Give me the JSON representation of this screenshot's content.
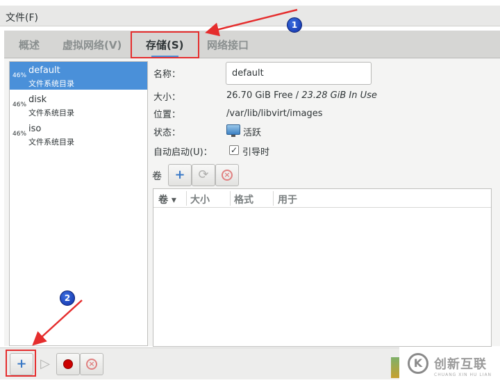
{
  "menubar": {
    "file_menu": "文件(F)"
  },
  "tabs": [
    {
      "label": "概述",
      "active": false
    },
    {
      "label": "虚拟网络(V)",
      "active": false
    },
    {
      "label": "存储(S)",
      "active": true
    },
    {
      "label": "网络接口",
      "active": false
    }
  ],
  "pools": [
    {
      "percent": "46%",
      "name": "default",
      "type": "文件系统目录",
      "selected": true
    },
    {
      "percent": "46%",
      "name": "disk",
      "type": "文件系统目录",
      "selected": false
    },
    {
      "percent": "46%",
      "name": "iso",
      "type": "文件系统目录",
      "selected": false
    }
  ],
  "details": {
    "name_label": "名称：",
    "name_value": "default",
    "size_label": "大小：",
    "size_free": "26.70 GiB Free / ",
    "size_in_use": "23.28 GiB In Use",
    "location_label": "位置：",
    "location_value": "/var/lib/libvirt/images",
    "state_label": "状态：",
    "state_value": "活跃",
    "autostart_label": "自动启动(U)：",
    "autostart_value": "引导时",
    "autostart_checked": true,
    "check_mark": "✓"
  },
  "volumes": {
    "label": "卷",
    "columns": [
      "卷",
      "大小",
      "格式",
      "用于"
    ],
    "sort_indicator": "▾",
    "rows": []
  },
  "toolbar_glyphs": {
    "add": "+",
    "refresh": "⟳",
    "delete": "×",
    "play": "▷"
  },
  "annotations": {
    "badge1": "1",
    "badge2": "2"
  },
  "watermark": {
    "logo_letter": "K",
    "text": "创新互联",
    "sub": "CHUANG XIN HU LIAN"
  },
  "colors": {
    "selection": "#4a90d9",
    "annotation_red": "#e52d2d",
    "badge_blue": "#1a45c8"
  }
}
